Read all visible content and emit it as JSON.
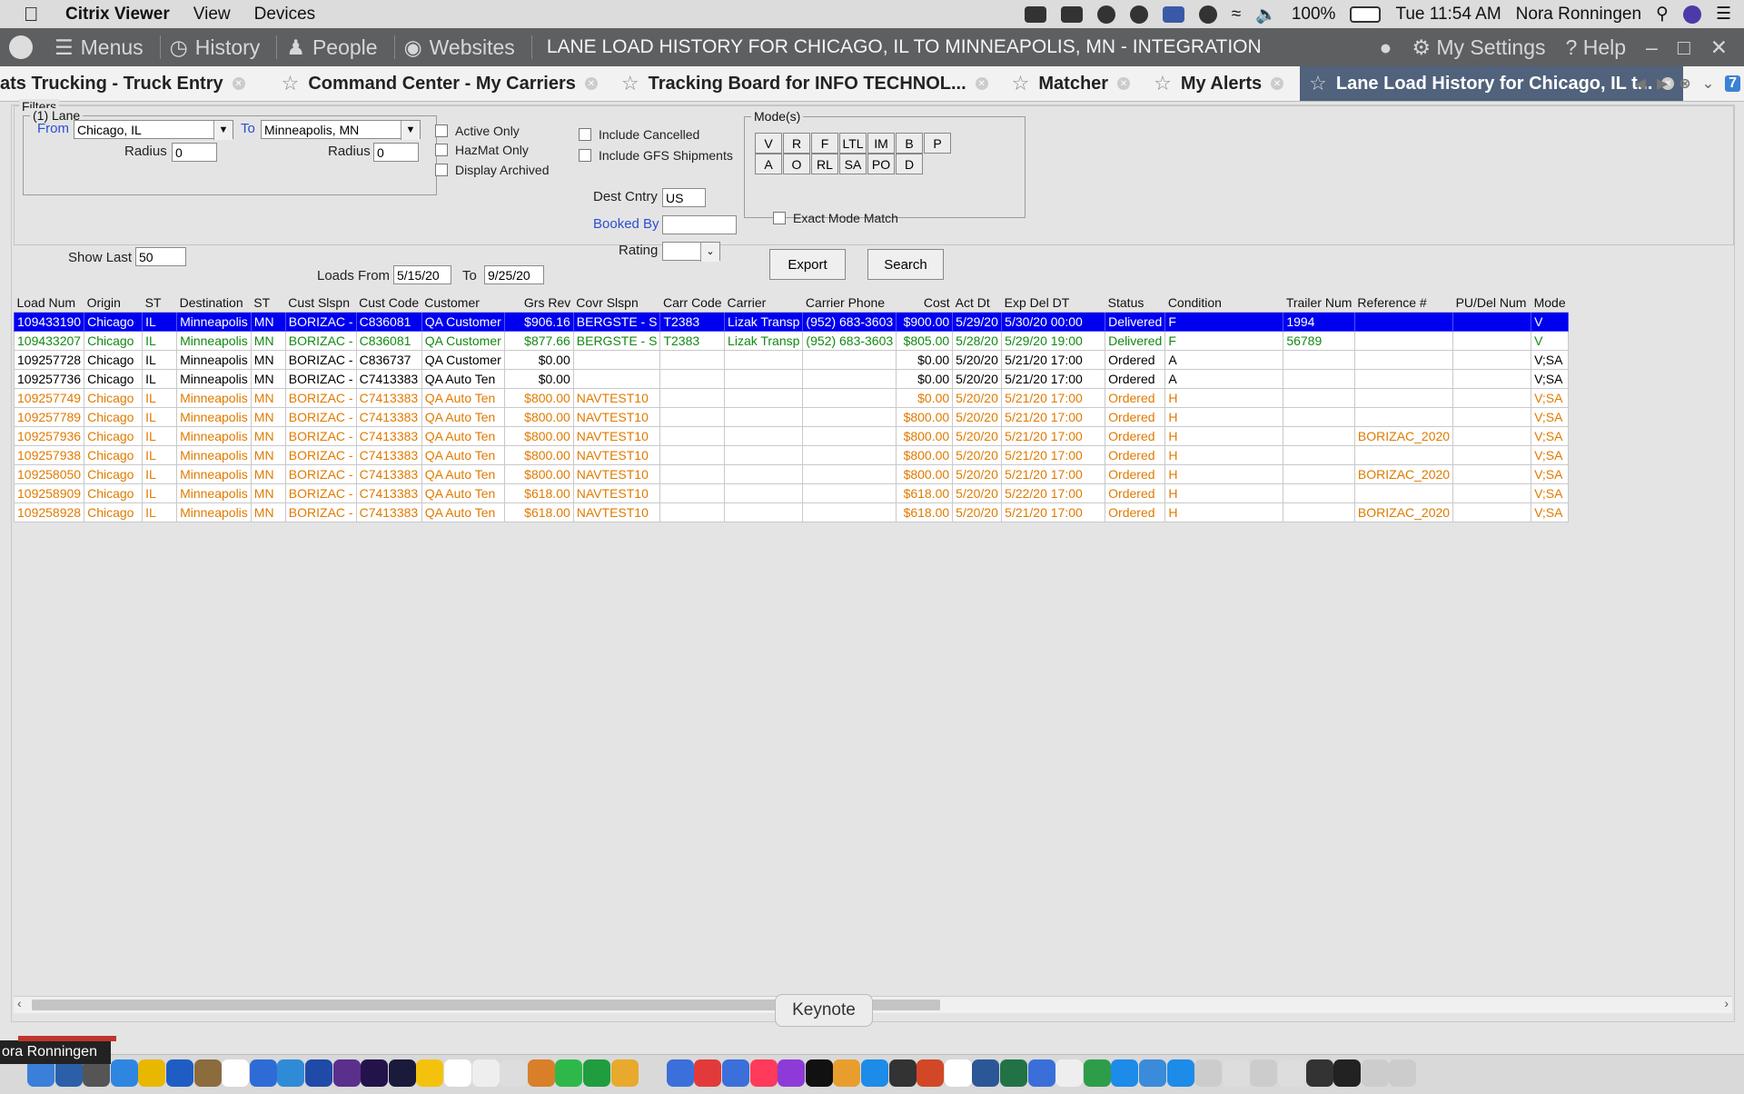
{
  "mac_menu": {
    "app_name": "Citrix Viewer",
    "items": [
      "View",
      "Devices"
    ],
    "battery": "100%",
    "clock": "Tue 11:54 AM",
    "user": "Nora Ronningen"
  },
  "toolbar": {
    "menus": "Menus",
    "history": "History",
    "people": "People",
    "websites": "Websites",
    "title": "LANE LOAD HISTORY FOR CHICAGO, IL TO MINNEAPOLIS, MN - INTEGRATION",
    "my_settings": "My Settings",
    "help": "Help"
  },
  "tabs": [
    "ats Trucking - Truck Entry",
    "Command Center - My Carriers",
    "Tracking Board for INFO TECHNOL...",
    "Matcher",
    "My Alerts",
    "Lane Load History for Chicago, IL t..."
  ],
  "tab_badge": "7",
  "filters": {
    "legend": "Filters",
    "lane_legend": "(1) Lane",
    "from_label": "From",
    "from_value": "Chicago, IL",
    "to_label": "To",
    "to_value": "Minneapolis, MN",
    "radius_label": "Radius",
    "radius_from": "0",
    "radius_to": "0",
    "active_only": "Active Only",
    "hazmat_only": "HazMat Only",
    "display_archived": "Display Archived",
    "include_cancelled": "Include Cancelled",
    "include_gfs": "Include GFS Shipments",
    "dest_cntry_label": "Dest Cntry",
    "dest_cntry_value": "US",
    "booked_by_label": "Booked By",
    "booked_by_value": "",
    "rating_label": "Rating",
    "rating_value": "",
    "show_last_label": "Show Last",
    "show_last_value": "50",
    "loads_from_label": "Loads From",
    "loads_from_value": "5/15/20",
    "loads_to_label": "To",
    "loads_to_value": "9/25/20",
    "modes_legend": "Mode(s)",
    "modes_row1": [
      "V",
      "R",
      "F",
      "LTL",
      "IM",
      "B",
      "P"
    ],
    "modes_row2": [
      "A",
      "O",
      "RL",
      "SA",
      "PO",
      "D"
    ],
    "exact_mode": "Exact Mode Match",
    "export": "Export",
    "search": "Search"
  },
  "grid": {
    "columns": [
      "Load Num",
      "Origin",
      "ST",
      "Destination",
      "ST",
      "Cust Slspn",
      "Cust Code",
      "Customer",
      "Grs Rev",
      "Covr Slspn",
      "Carr Code",
      "Carrier",
      "Carrier Phone",
      "Cost",
      "Act Dt",
      "Exp Del DT",
      "Status",
      "Condition",
      "Trailer Num",
      "Reference #",
      "PU/Del Num",
      "Mode"
    ],
    "rows": [
      {
        "style": "selected",
        "cells": [
          "109433190",
          "Chicago",
          "IL",
          "Minneapolis",
          "MN",
          "BORIZAC -",
          "C836081",
          "QA Customer",
          "$906.16",
          "BERGSTE - S",
          "T2383",
          "Lizak Transp",
          "(952) 683-3603",
          "$900.00",
          "5/29/20",
          "5/30/20 00:00",
          "Delivered",
          "F",
          "1994",
          "",
          "",
          "V"
        ]
      },
      {
        "style": "delivered",
        "cells": [
          "109433207",
          "Chicago",
          "IL",
          "Minneapolis",
          "MN",
          "BORIZAC -",
          "C836081",
          "QA Customer",
          "$877.66",
          "BERGSTE - S",
          "T2383",
          "Lizak Transp",
          "(952) 683-3603",
          "$805.00",
          "5/28/20",
          "5/29/20 19:00",
          "Delivered",
          "F",
          "56789",
          "",
          "",
          "V"
        ]
      },
      {
        "style": "ordered",
        "cells": [
          "109257728",
          "Chicago",
          "IL",
          "Minneapolis",
          "MN",
          "BORIZAC -",
          "C836737",
          "QA Customer",
          "$0.00",
          "",
          "",
          "",
          "",
          "$0.00",
          "5/20/20",
          "5/21/20 17:00",
          "Ordered",
          "A",
          "",
          "",
          "",
          "V;SA"
        ]
      },
      {
        "style": "ordered",
        "cells": [
          "109257736",
          "Chicago",
          "IL",
          "Minneapolis",
          "MN",
          "BORIZAC -",
          "C7413383",
          "QA Auto Ten",
          "$0.00",
          "",
          "",
          "",
          "",
          "$0.00",
          "5/20/20",
          "5/21/20 17:00",
          "Ordered",
          "A",
          "",
          "",
          "",
          "V;SA"
        ]
      },
      {
        "style": "navtest",
        "cells": [
          "109257749",
          "Chicago",
          "IL",
          "Minneapolis",
          "MN",
          "BORIZAC -",
          "C7413383",
          "QA Auto Ten",
          "$800.00",
          "NAVTEST10",
          "",
          "",
          "",
          "$0.00",
          "5/20/20",
          "5/21/20 17:00",
          "Ordered",
          "H",
          "",
          "",
          "",
          "V;SA"
        ]
      },
      {
        "style": "navtest",
        "cells": [
          "109257789",
          "Chicago",
          "IL",
          "Minneapolis",
          "MN",
          "BORIZAC -",
          "C7413383",
          "QA Auto Ten",
          "$800.00",
          "NAVTEST10",
          "",
          "",
          "",
          "$800.00",
          "5/20/20",
          "5/21/20 17:00",
          "Ordered",
          "H",
          "",
          "",
          "",
          "V;SA"
        ]
      },
      {
        "style": "navtest",
        "cells": [
          "109257936",
          "Chicago",
          "IL",
          "Minneapolis",
          "MN",
          "BORIZAC -",
          "C7413383",
          "QA Auto Ten",
          "$800.00",
          "NAVTEST10",
          "",
          "",
          "",
          "$800.00",
          "5/20/20",
          "5/21/20 17:00",
          "Ordered",
          "H",
          "",
          "BORIZAC_2020",
          "",
          "V;SA"
        ]
      },
      {
        "style": "navtest",
        "cells": [
          "109257938",
          "Chicago",
          "IL",
          "Minneapolis",
          "MN",
          "BORIZAC -",
          "C7413383",
          "QA Auto Ten",
          "$800.00",
          "NAVTEST10",
          "",
          "",
          "",
          "$800.00",
          "5/20/20",
          "5/21/20 17:00",
          "Ordered",
          "H",
          "",
          "",
          "",
          "V;SA"
        ]
      },
      {
        "style": "navtest",
        "cells": [
          "109258050",
          "Chicago",
          "IL",
          "Minneapolis",
          "MN",
          "BORIZAC -",
          "C7413383",
          "QA Auto Ten",
          "$800.00",
          "NAVTEST10",
          "",
          "",
          "",
          "$800.00",
          "5/20/20",
          "5/21/20 17:00",
          "Ordered",
          "H",
          "",
          "BORIZAC_2020",
          "",
          "V;SA"
        ]
      },
      {
        "style": "navtest",
        "cells": [
          "109258909",
          "Chicago",
          "IL",
          "Minneapolis",
          "MN",
          "BORIZAC -",
          "C7413383",
          "QA Auto Ten",
          "$618.00",
          "NAVTEST10",
          "",
          "",
          "",
          "$618.00",
          "5/20/20",
          "5/22/20 17:00",
          "Ordered",
          "H",
          "",
          "",
          "",
          "V;SA"
        ]
      },
      {
        "style": "navtest",
        "cells": [
          "109258928",
          "Chicago",
          "IL",
          "Minneapolis",
          "MN",
          "BORIZAC -",
          "C7413383",
          "QA Auto Ten",
          "$618.00",
          "NAVTEST10",
          "",
          "",
          "",
          "$618.00",
          "5/20/20",
          "5/21/20 17:00",
          "Ordered",
          "H",
          "",
          "BORIZAC_2020",
          "",
          "V;SA"
        ]
      }
    ]
  },
  "tooltip": "Keynote",
  "name_tag": "ora Ronningen"
}
